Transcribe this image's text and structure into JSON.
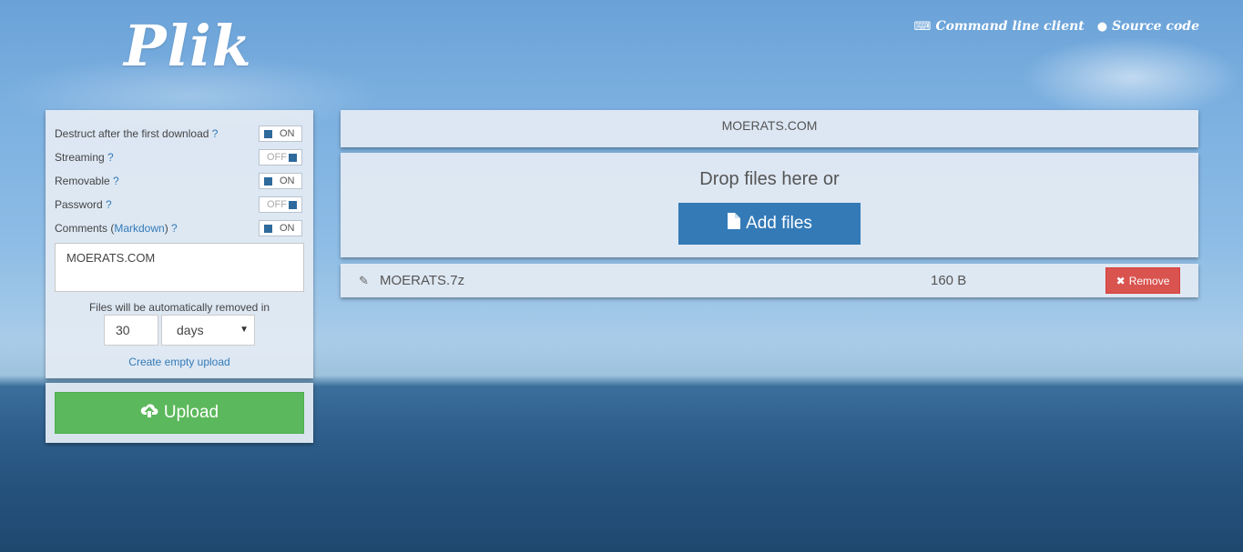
{
  "brand": {
    "logo": "Plik"
  },
  "header": {
    "cli_label": "Command line client",
    "source_label": "Source code"
  },
  "options": {
    "destruct": {
      "label": "Destruct after the first download",
      "help": "?",
      "state": "ON"
    },
    "streaming": {
      "label": "Streaming",
      "help": "?",
      "state": "OFF"
    },
    "removable": {
      "label": "Removable",
      "help": "?",
      "state": "ON"
    },
    "password": {
      "label": "Password",
      "help": "?",
      "state": "OFF"
    },
    "comments": {
      "label": "Comments (",
      "link": "Markdown",
      "close": ")",
      "help": "?",
      "state": "ON"
    }
  },
  "comments_value": "MOERATS.COM",
  "expiry": {
    "label": "Files will be automatically removed in",
    "value": "30",
    "unit": "days"
  },
  "create_empty_label": "Create empty upload",
  "upload_label": "Upload",
  "comment_display": "MOERATS.COM",
  "dropzone": {
    "text": "Drop files here or",
    "button": "Add files"
  },
  "files": [
    {
      "name": "MOERATS.7z",
      "size": "160 B",
      "remove_label": "Remove"
    }
  ],
  "colors": {
    "upload": "#5cb85c",
    "add": "#337ab7",
    "remove": "#d9534f",
    "toggle": "#2e6a9c"
  }
}
